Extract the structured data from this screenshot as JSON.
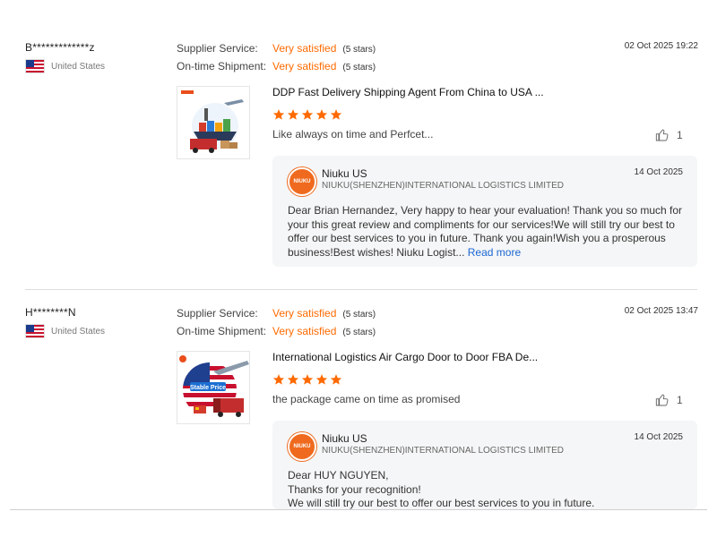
{
  "reviews": [
    {
      "buyer": "B*************z",
      "country": "United States",
      "date": "02 Oct 2025 19:22",
      "ratings": [
        {
          "label": "Supplier Service:",
          "value": "Very satisfied",
          "stars": "(5 stars)"
        },
        {
          "label": "On-time Shipment:",
          "value": "Very satisfied",
          "stars": "(5 stars)"
        }
      ],
      "product_title": "DDP Fast Delivery Shipping Agent From China to USA ...",
      "star_rating": 5,
      "comment": "Like always on time and Perfcet...",
      "helpful_count": "1",
      "reply": {
        "supplier": "Niuku US",
        "company": "NIUKU(SHENZHEN)INTERNATIONAL LOGISTICS LIMITED",
        "date": "14 Oct 2025",
        "text": "Dear Brian Hernandez, Very happy to hear your evaluation! Thank you so much for your this great review and compliments for our services!We will still try our best to offer our best services to you in future. Thank you again!Wish you a prosperous business!Best wishes!  Niuku Logist... ",
        "read_more": "Read more"
      }
    },
    {
      "buyer": "H********N",
      "country": "United States",
      "date": "02 Oct 2025 13:47",
      "ratings": [
        {
          "label": "Supplier Service:",
          "value": "Very satisfied",
          "stars": "(5 stars)"
        },
        {
          "label": "On-time Shipment:",
          "value": "Very satisfied",
          "stars": "(5 stars)"
        }
      ],
      "product_title": "International Logistics Air Cargo Door to Door FBA De...",
      "product_badge": "Stable Price",
      "star_rating": 5,
      "comment": "the package came on time as promised",
      "helpful_count": "1",
      "reply": {
        "supplier": "Niuku US",
        "company": "NIUKU(SHENZHEN)INTERNATIONAL LOGISTICS LIMITED",
        "date": "14 Oct 2025",
        "text": "Dear HUY NGUYEN,\nThanks for your recognition!\nWe will still try our best to offer our best services to you in future."
      }
    }
  ],
  "logo_text": "NIUKU",
  "colors": {
    "accent": "#ff6a00",
    "link": "#1a66d2",
    "reply_bg": "#f5f6f7"
  }
}
